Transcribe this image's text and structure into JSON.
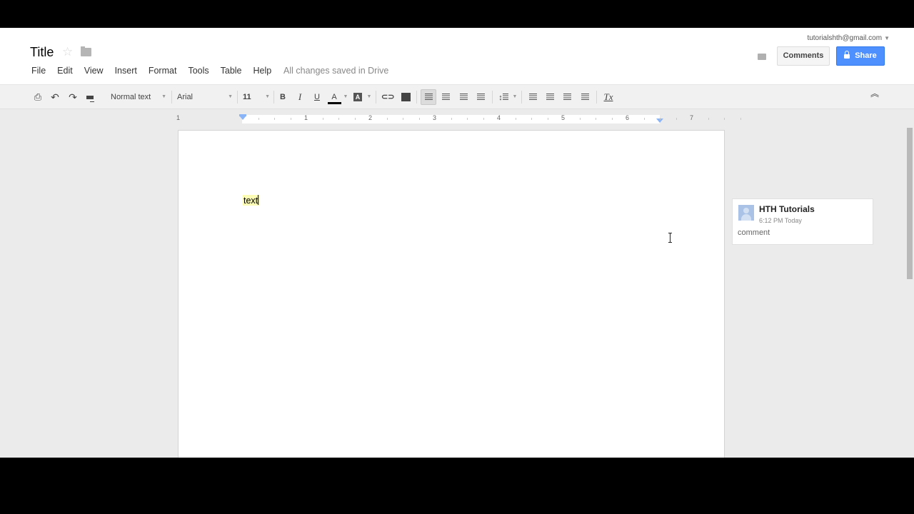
{
  "header": {
    "title": "Title",
    "account_email": "tutorialshth@gmail.com",
    "save_status": "All changes saved in Drive",
    "comments_label": "Comments",
    "share_label": "Share"
  },
  "menu": [
    "File",
    "Edit",
    "View",
    "Insert",
    "Format",
    "Tools",
    "Table",
    "Help"
  ],
  "toolbar": {
    "style_select": "Normal text",
    "font_select": "Arial",
    "size_select": "11",
    "bold": "B",
    "italic": "I",
    "underline": "U",
    "text_color": "A",
    "highlight": "A",
    "clear_format": "Tx",
    "text_color_value": "#000000"
  },
  "ruler": {
    "labels": [
      "1",
      "1",
      "2",
      "3",
      "4",
      "5",
      "6",
      "7"
    ]
  },
  "document": {
    "body_text": "text",
    "highlight_color": "#fcfcb4"
  },
  "comment": {
    "author": "HTH Tutorials",
    "time": "6:12 PM Today",
    "text": "comment"
  },
  "colors": {
    "share_blue": "#4d90fe"
  }
}
